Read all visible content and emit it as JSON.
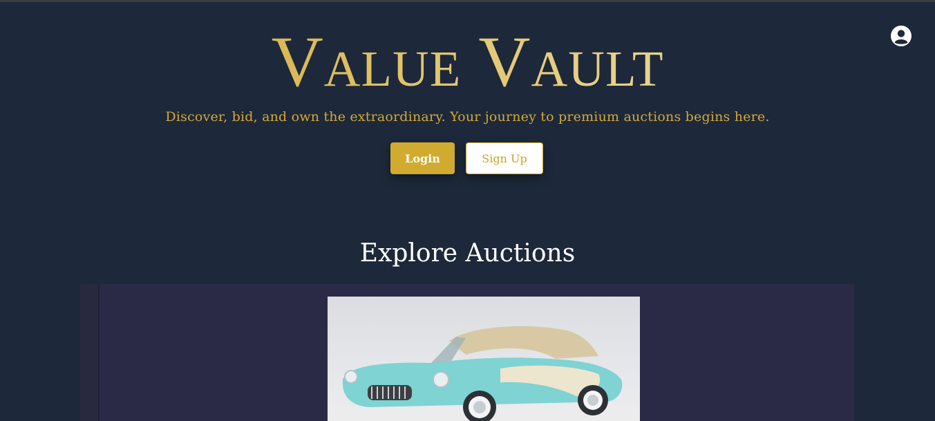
{
  "header": {
    "brand": "Value Vault",
    "tagline": "Discover, bid, and own the extraordinary. Your journey to premium auctions begins here.",
    "login_label": "Login",
    "signup_label": "Sign Up",
    "profile_icon": "user-circle-icon"
  },
  "auctions": {
    "title": "Explore Auctions",
    "slides": [
      {
        "image": "classic-convertible-car-image"
      }
    ]
  },
  "colors": {
    "background": "#1d283a",
    "gold": "#d1ab30",
    "carousel_bg": "#2b2a46"
  }
}
